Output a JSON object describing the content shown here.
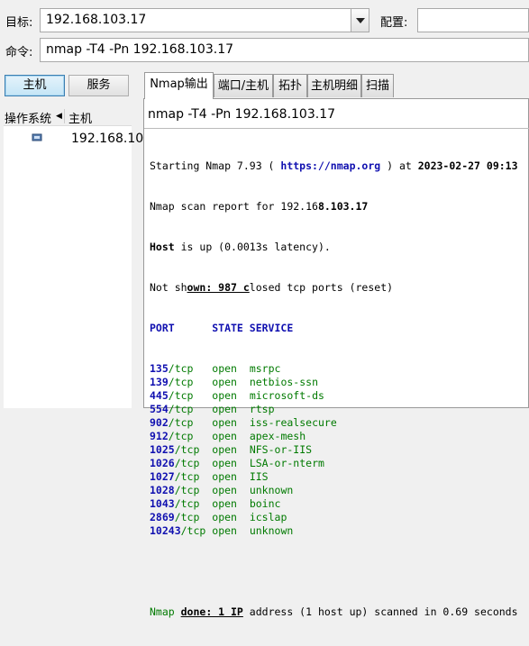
{
  "target": {
    "label": "目标:",
    "value": "192.168.103.17"
  },
  "profile": {
    "label": "配置:",
    "value": ""
  },
  "command": {
    "label": "命令:",
    "value": "nmap -T4 -Pn 192.168.103.17"
  },
  "left": {
    "host_button": "主机",
    "service_button": "服务",
    "col_os": "操作系统",
    "col_host": "主机",
    "hosts": [
      {
        "ip": "192.168.10"
      }
    ]
  },
  "tabs": [
    "Nmap输出",
    "端口/主机",
    "拓扑",
    "主机明细",
    "扫描"
  ],
  "output": {
    "command_display": "nmap -T4 -Pn 192.168.103.17",
    "starting_prefix": "Starting Nmap 7.93 ( ",
    "starting_url": "https://nmap.org",
    "starting_mid": " ) at ",
    "starting_date": "2023-02-27 09:13",
    "report_prefix": "Nmap scan report for 192.16",
    "report_bold": "8.103.17",
    "host_bold": "Host",
    "host_rest": " is up (0.0013s latency).",
    "notshown_a": "Not sh",
    "notshown_b": "own: 987 c",
    "notshown_c": "losed tcp ports (reset)",
    "header": "PORT      STATE SERVICE",
    "ports": [
      {
        "num": "135",
        "proto": "/tcp",
        "pad": "   ",
        "state": "open",
        "service": "msrpc"
      },
      {
        "num": "139",
        "proto": "/tcp",
        "pad": "   ",
        "state": "open",
        "service": "netbios-ssn"
      },
      {
        "num": "445",
        "proto": "/tcp",
        "pad": "   ",
        "state": "open",
        "service": "microsoft-ds"
      },
      {
        "num": "554",
        "proto": "/tcp",
        "pad": "   ",
        "state": "open",
        "service": "rtsp"
      },
      {
        "num": "902",
        "proto": "/tcp",
        "pad": "   ",
        "state": "open",
        "service": "iss-realsecure"
      },
      {
        "num": "912",
        "proto": "/tcp",
        "pad": "   ",
        "state": "open",
        "service": "apex-mesh"
      },
      {
        "num": "1025",
        "proto": "/tcp",
        "pad": "  ",
        "state": "open",
        "service": "NFS-or-IIS"
      },
      {
        "num": "1026",
        "proto": "/tcp",
        "pad": "  ",
        "state": "open",
        "service": "LSA-or-nterm"
      },
      {
        "num": "1027",
        "proto": "/tcp",
        "pad": "  ",
        "state": "open",
        "service": "IIS"
      },
      {
        "num": "1028",
        "proto": "/tcp",
        "pad": "  ",
        "state": "open",
        "service": "unknown"
      },
      {
        "num": "1043",
        "proto": "/tcp",
        "pad": "  ",
        "state": "open",
        "service": "boinc"
      },
      {
        "num": "2869",
        "proto": "/tcp",
        "pad": "  ",
        "state": "open",
        "service": "icslap"
      },
      {
        "num": "10243",
        "proto": "/tcp",
        "pad": " ",
        "state": "open",
        "service": "unknown"
      }
    ],
    "done_a": "Nmap ",
    "done_b": "done: 1 IP",
    "done_c": " address (1 host up) scanned in 0.69 seconds"
  }
}
